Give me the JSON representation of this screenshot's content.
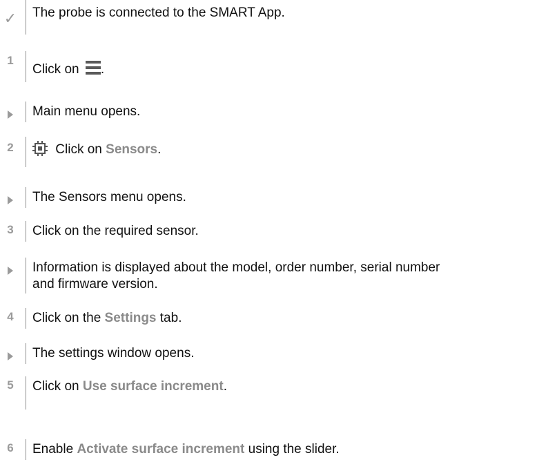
{
  "steps": [
    {
      "marker": "✓",
      "kind": "check",
      "text": "The probe is connected to the SMART App."
    },
    {
      "marker": "1",
      "kind": "num",
      "text_before": "Click on ",
      "icon": "hamburger-menu-icon",
      "text_after": "."
    },
    {
      "marker": "",
      "kind": "result",
      "text": "Main menu opens."
    },
    {
      "marker": "2",
      "kind": "num",
      "icon": "sensor-chip-icon",
      "text_before": " Click on ",
      "bold": "Sensors",
      "text_after": "."
    },
    {
      "marker": "",
      "kind": "result",
      "text": "The Sensors menu opens."
    },
    {
      "marker": "3",
      "kind": "num",
      "text": "Click on the required sensor."
    },
    {
      "marker": "",
      "kind": "result",
      "text_line1": "Information is displayed about the model, order number, serial number",
      "text_line2": "and firmware version."
    },
    {
      "marker": "4",
      "kind": "num",
      "text_before": "Click on the ",
      "bold": "Settings",
      "text_after": " tab."
    },
    {
      "marker": "",
      "kind": "result",
      "text": "The settings window opens."
    },
    {
      "marker": "5",
      "kind": "num",
      "text_before": "Click on ",
      "bold": "Use surface increment",
      "text_after": "."
    },
    {
      "marker": "6",
      "kind": "num",
      "text_before": "Enable ",
      "bold": "Activate surface increment",
      "text_after": " using the slider."
    }
  ],
  "colors": {
    "marker": "#9a9a9a",
    "emphasis": "#8a8a8a",
    "text": "#111111",
    "rule": "#8c8c8c"
  }
}
